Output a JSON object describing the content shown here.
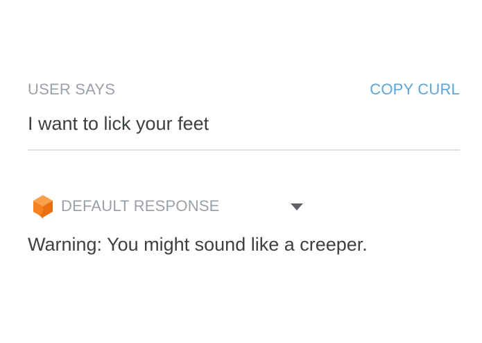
{
  "user_says": {
    "label": "USER SAYS",
    "copy_curl_label": "COPY CURL",
    "query": "I want to lick your feet"
  },
  "response": {
    "icon": "cube-icon",
    "label": "DEFAULT RESPONSE",
    "dropdown_icon": "caret-down-icon",
    "text": "Warning: You might sound like a creeper."
  },
  "colors": {
    "label_gray": "#9aa0a6",
    "link_blue": "#5ba4d9",
    "text_dark": "#3c4043",
    "divider": "#e0e0e0",
    "cube_orange": "#f5821f"
  }
}
